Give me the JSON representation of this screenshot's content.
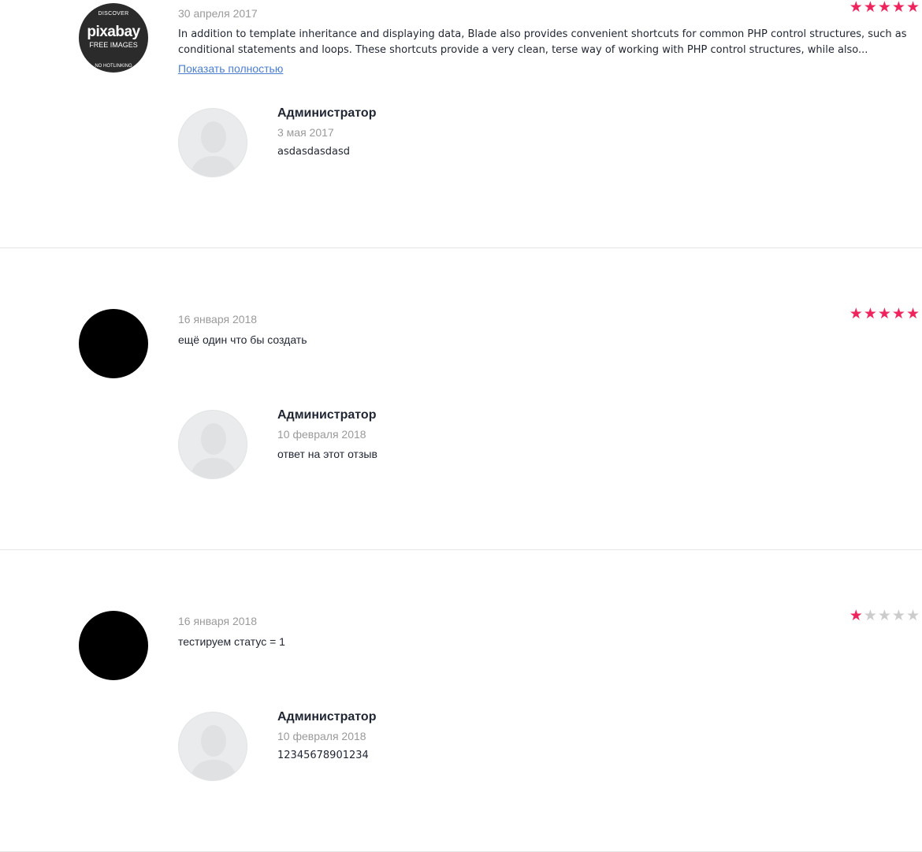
{
  "reviews": [
    {
      "date": "30 апреля 2017",
      "text": "In addition to template inheritance and displaying data, Blade also provides convenient shortcuts for common PHP control structures, such as conditional statements and loops. These shortcuts provide a very clean, terse way of working with PHP control structures, while also...",
      "show_more": "Показать полностью",
      "rating": 5,
      "avatar_logo": {
        "line1": "DISCOVER",
        "line2": "pixabay",
        "line3": "FREE IMAGES",
        "line4": "NO HOTLINKING"
      },
      "reply": {
        "author": "Администратор",
        "date": "3 мая 2017",
        "text": "asdasdasdasd"
      }
    },
    {
      "date": "16 января 2018",
      "text": "ещё один что бы создать",
      "rating": 5,
      "reply": {
        "author": "Администратор",
        "date": "10 февраля 2018",
        "text": "ответ на этот отзыв"
      }
    },
    {
      "date": "16 января 2018",
      "text": "тестируем статус = 1",
      "rating": 1,
      "reply": {
        "author": "Администратор",
        "date": "10 февраля 2018",
        "text": "12345678901234"
      }
    }
  ],
  "star_char": "★",
  "colors": {
    "star_active": "#f0245c",
    "star_inactive": "#cccccc",
    "link": "#4a7fd0",
    "date": "#9a9a9a"
  }
}
